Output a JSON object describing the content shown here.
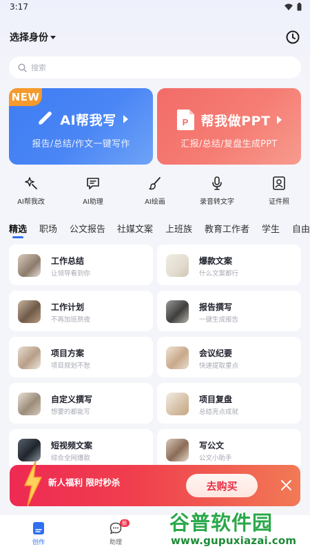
{
  "status_bar": {
    "time": "3:17"
  },
  "header": {
    "identity_label": "选择身份"
  },
  "search": {
    "placeholder": "搜索"
  },
  "hero_cards": [
    {
      "tag": "NEW",
      "title": "AI帮我写",
      "subtitle": "报告/总结/作文一键写作",
      "color": "#3d7cf2"
    },
    {
      "title": "帮我做PPT",
      "subtitle": "汇报/总结/复盘生成PPT",
      "color": "#f26c68"
    }
  ],
  "tools": [
    {
      "label": "AI帮我改",
      "icon": "magic-wand-icon"
    },
    {
      "label": "AI助理",
      "icon": "chat-assistant-icon"
    },
    {
      "label": "AI绘画",
      "icon": "brush-icon"
    },
    {
      "label": "录音转文字",
      "icon": "microphone-icon"
    },
    {
      "label": "证件照",
      "icon": "id-photo-icon"
    }
  ],
  "categories": [
    "精选",
    "职场",
    "公文报告",
    "社媒文案",
    "上班族",
    "教育工作者",
    "学生",
    "自由"
  ],
  "active_category": "精选",
  "cards": [
    {
      "title": "工作总结",
      "subtitle": "让领导看到你"
    },
    {
      "title": "爆款文案",
      "subtitle": "什么文案都行"
    },
    {
      "title": "工作计划",
      "subtitle": "不再加班熬夜"
    },
    {
      "title": "报告撰写",
      "subtitle": "一键生成报告"
    },
    {
      "title": "项目方案",
      "subtitle": "项目规划不愁"
    },
    {
      "title": "会议纪要",
      "subtitle": "快速提取重点"
    },
    {
      "title": "自定义撰写",
      "subtitle": "想要的都能写"
    },
    {
      "title": "项目复盘",
      "subtitle": "总结亮点成就"
    },
    {
      "title": "短视频文案",
      "subtitle": "综合全网爆款"
    },
    {
      "title": "写公文",
      "subtitle": "公文小助手"
    }
  ],
  "promo": {
    "text": "新人福利 限时秒杀",
    "button": "去购买"
  },
  "tabbar": {
    "items": [
      {
        "label": "创作",
        "active": true
      },
      {
        "label": "助理",
        "badge": "新"
      }
    ]
  },
  "watermark": {
    "title": "谷普软件园",
    "url": "www.gupuxiazai.com"
  },
  "colors": {
    "accent": "#2f6ff0",
    "promo": "#ee2a53",
    "ppt": "#f26c68"
  }
}
